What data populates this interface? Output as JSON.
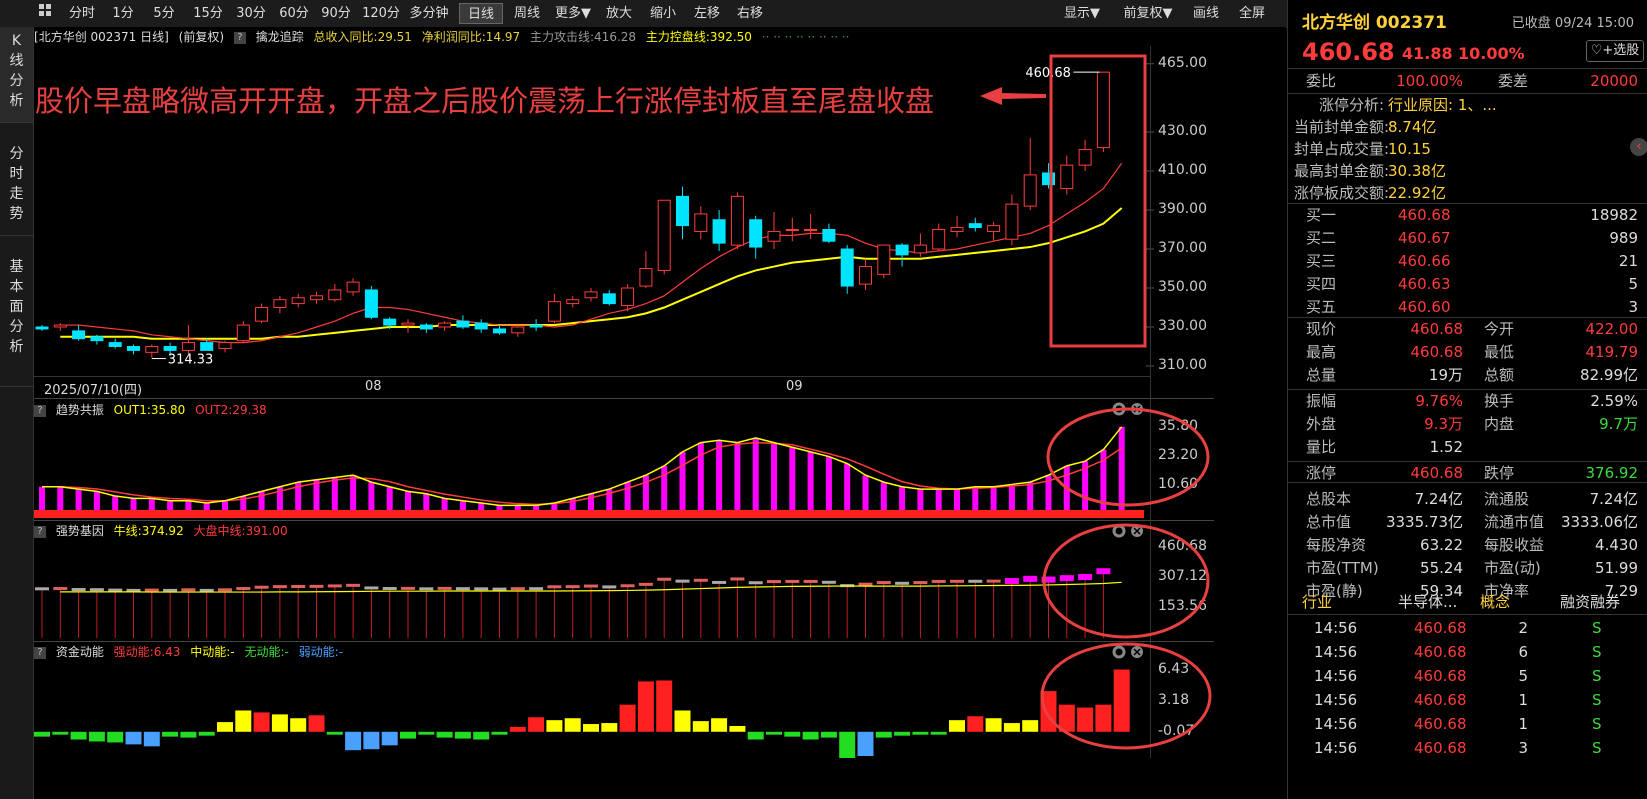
{
  "toolbar": {
    "items": [
      "分时",
      "1分",
      "5分",
      "15分",
      "30分",
      "60分",
      "90分",
      "120分",
      "多分钟",
      "日线",
      "周线",
      "更多▼",
      "放大",
      "缩小",
      "左移",
      "右移"
    ],
    "active": "日线",
    "right_items": [
      "显示▼",
      "前复权▼",
      "画线",
      "全屏"
    ]
  },
  "left_tabs": [
    {
      "label": "K线分析",
      "active": true
    },
    {
      "label": "分时走势",
      "active": false
    },
    {
      "label": "基本面分析",
      "active": false
    }
  ],
  "main_header": {
    "title": "北方华创 002371 日线",
    "adjust": "(前复权)",
    "indicator": "擒龙追踪",
    "revenue": "总收入同比:29.51",
    "profit": "净利润同比:14.97",
    "attack": "主力攻击线:416.28",
    "control": "主力控盘线:392.50",
    "dots": "·· ·· ·· ·· ·· ·· ·· ··"
  },
  "annotation": "股价早盘略微高开开盘，开盘之后股价震荡上行涨停封板直至尾盘收盘",
  "colors": {
    "up": "#ff3c3c",
    "down": "#00e5ff",
    "ma_fast": "#ff3c3c",
    "ma_slow": "#ffff00",
    "highlight": "#e84040",
    "magenta": "#ff00ff"
  },
  "chart_data": [
    {
      "type": "candlestick",
      "title": "北方华创 002371 日线",
      "ylim": [
        310,
        470
      ],
      "yticks": [
        "465.00",
        "430.00",
        "410.00",
        "390.00",
        "370.00",
        "350.00",
        "330.00",
        "310.00"
      ],
      "x_labels": [
        "2025/07/10(四)",
        "08",
        "09"
      ],
      "high_label": "460.68",
      "low_label": "314.33",
      "candles": [
        {
          "o": 330,
          "h": 331,
          "l": 328,
          "c": 329
        },
        {
          "o": 330,
          "h": 332,
          "l": 328,
          "c": 331
        },
        {
          "o": 328,
          "h": 331,
          "l": 323,
          "c": 324
        },
        {
          "o": 325,
          "h": 326,
          "l": 321,
          "c": 323
        },
        {
          "o": 322,
          "h": 324,
          "l": 319,
          "c": 320
        },
        {
          "o": 320,
          "h": 321,
          "l": 316,
          "c": 318
        },
        {
          "o": 317,
          "h": 321,
          "l": 314.33,
          "c": 320
        },
        {
          "o": 320,
          "h": 322,
          "l": 315,
          "c": 318
        },
        {
          "o": 318,
          "h": 331,
          "l": 316,
          "c": 322
        },
        {
          "o": 322,
          "h": 324,
          "l": 318,
          "c": 318
        },
        {
          "o": 319,
          "h": 323,
          "l": 317,
          "c": 322
        },
        {
          "o": 323,
          "h": 333,
          "l": 322,
          "c": 331
        },
        {
          "o": 333,
          "h": 342,
          "l": 332,
          "c": 340
        },
        {
          "o": 340,
          "h": 346,
          "l": 337,
          "c": 344
        },
        {
          "o": 342,
          "h": 347,
          "l": 340,
          "c": 345
        },
        {
          "o": 344,
          "h": 348,
          "l": 342,
          "c": 346
        },
        {
          "o": 344,
          "h": 352,
          "l": 343,
          "c": 349
        },
        {
          "o": 348,
          "h": 355,
          "l": 346,
          "c": 353
        },
        {
          "o": 349,
          "h": 351,
          "l": 334,
          "c": 335
        },
        {
          "o": 334,
          "h": 335,
          "l": 329,
          "c": 331
        },
        {
          "o": 331,
          "h": 334,
          "l": 327,
          "c": 332
        },
        {
          "o": 331,
          "h": 332,
          "l": 327,
          "c": 329
        },
        {
          "o": 330,
          "h": 333,
          "l": 328,
          "c": 332
        },
        {
          "o": 333,
          "h": 336,
          "l": 329,
          "c": 330
        },
        {
          "o": 332,
          "h": 334,
          "l": 327,
          "c": 329
        },
        {
          "o": 329,
          "h": 331,
          "l": 326,
          "c": 327
        },
        {
          "o": 327,
          "h": 331,
          "l": 325,
          "c": 330
        },
        {
          "o": 331,
          "h": 334,
          "l": 328,
          "c": 330
        },
        {
          "o": 333,
          "h": 347,
          "l": 332,
          "c": 343
        },
        {
          "o": 342,
          "h": 346,
          "l": 340,
          "c": 344
        },
        {
          "o": 345,
          "h": 350,
          "l": 343,
          "c": 348
        },
        {
          "o": 347,
          "h": 349,
          "l": 341,
          "c": 342
        },
        {
          "o": 341,
          "h": 352,
          "l": 338,
          "c": 350
        },
        {
          "o": 351,
          "h": 369,
          "l": 350,
          "c": 360
        },
        {
          "o": 359,
          "h": 395,
          "l": 357,
          "c": 395
        },
        {
          "o": 397,
          "h": 402,
          "l": 375,
          "c": 382
        },
        {
          "o": 379,
          "h": 392,
          "l": 375,
          "c": 388
        },
        {
          "o": 385,
          "h": 390,
          "l": 369,
          "c": 373
        },
        {
          "o": 372,
          "h": 399,
          "l": 370,
          "c": 397
        },
        {
          "o": 385,
          "h": 387,
          "l": 365,
          "c": 371
        },
        {
          "o": 374,
          "h": 389,
          "l": 370,
          "c": 379
        },
        {
          "o": 380,
          "h": 386,
          "l": 374,
          "c": 380
        },
        {
          "o": 380,
          "h": 388,
          "l": 375,
          "c": 380
        },
        {
          "o": 380,
          "h": 383,
          "l": 373,
          "c": 374
        },
        {
          "o": 370,
          "h": 372,
          "l": 347,
          "c": 351
        },
        {
          "o": 352,
          "h": 365,
          "l": 349,
          "c": 361
        },
        {
          "o": 357,
          "h": 372,
          "l": 355,
          "c": 372
        },
        {
          "o": 372,
          "h": 373,
          "l": 361,
          "c": 367
        },
        {
          "o": 368,
          "h": 378,
          "l": 366,
          "c": 372
        },
        {
          "o": 370,
          "h": 383,
          "l": 369,
          "c": 380
        },
        {
          "o": 379,
          "h": 387,
          "l": 376,
          "c": 381
        },
        {
          "o": 383,
          "h": 386,
          "l": 379,
          "c": 381
        },
        {
          "o": 379,
          "h": 384,
          "l": 374,
          "c": 382
        },
        {
          "o": 375,
          "h": 398,
          "l": 372,
          "c": 393
        },
        {
          "o": 392,
          "h": 427,
          "l": 390,
          "c": 408
        },
        {
          "o": 409,
          "h": 414,
          "l": 401,
          "c": 403
        },
        {
          "o": 401,
          "h": 418,
          "l": 398,
          "c": 413
        },
        {
          "o": 413,
          "h": 426,
          "l": 410,
          "c": 421
        },
        {
          "o": 422,
          "h": 460.68,
          "l": 419.79,
          "c": 460.68
        }
      ],
      "ma_fast": [
        331,
        331,
        330,
        329,
        328,
        326,
        325,
        324,
        323,
        322,
        322,
        323,
        325,
        327,
        330,
        333,
        337,
        340,
        340,
        339,
        337,
        335,
        333,
        332,
        331,
        331,
        331,
        330,
        331,
        334,
        337,
        339,
        342,
        346,
        353,
        360,
        366,
        371,
        375,
        377,
        377,
        378,
        378,
        377,
        373,
        370,
        369,
        368,
        369,
        370,
        372,
        374,
        376,
        378,
        382,
        388,
        394,
        401,
        414
      ],
      "ma_slow": [
        325,
        325,
        325,
        325,
        325,
        324,
        324,
        324,
        324,
        324,
        324,
        324,
        325,
        325,
        326,
        327,
        328,
        329,
        330,
        330,
        330,
        331,
        331,
        331,
        331,
        331,
        331,
        331,
        332,
        333,
        334,
        335,
        337,
        340,
        344,
        348,
        352,
        356,
        359,
        361,
        363,
        364,
        365,
        366,
        365,
        365,
        365,
        365,
        366,
        367,
        368,
        369,
        370,
        371,
        373,
        376,
        379,
        383,
        391
      ]
    },
    {
      "type": "bar",
      "title": "趋势共振",
      "legend": [
        "OUT1:35.80",
        "OUT2:29.38"
      ],
      "ylim": [
        0,
        37
      ],
      "yticks": [
        "35.80",
        "23.20",
        "10.60"
      ],
      "values": [
        10,
        10,
        9,
        8,
        6,
        5,
        5,
        4,
        4,
        3,
        4,
        6,
        8,
        10,
        12,
        13,
        14,
        15,
        12,
        10,
        8,
        7,
        5,
        4,
        3,
        2,
        2,
        2,
        3,
        5,
        7,
        9,
        12,
        15,
        19,
        25,
        29,
        30,
        29,
        31,
        29,
        27,
        25,
        23,
        20,
        15,
        12,
        10,
        9,
        9,
        9,
        10,
        10,
        11,
        12,
        15,
        19,
        21,
        26,
        35.8
      ]
    },
    {
      "type": "bar",
      "title": "强势基因",
      "legend": [
        "牛线:374.92",
        "大盘中线:391.00"
      ],
      "ylim": [
        0,
        470
      ],
      "yticks": [
        "460.68",
        "307.12",
        "153.56"
      ]
    },
    {
      "type": "bar",
      "title": "资金动能",
      "legend": [
        "强动能:6.43",
        "中动能:-",
        "无动能:-",
        "弱动能:-"
      ],
      "ylim": [
        -2.5,
        7
      ],
      "yticks": [
        "6.43",
        "3.18",
        "-0.07"
      ],
      "values": [
        -0.5,
        -0.3,
        -0.8,
        -1.0,
        -1.1,
        -1.3,
        -1.5,
        -0.5,
        -0.6,
        -0.4,
        1.0,
        2.2,
        2.0,
        1.8,
        1.4,
        1.7,
        -0.3,
        -1.9,
        -1.8,
        -1.4,
        -0.7,
        -0.3,
        -0.6,
        -0.7,
        -0.8,
        -0.3,
        0.5,
        1.5,
        1.2,
        1.4,
        0.8,
        0.9,
        2.8,
        5.2,
        5.3,
        2.2,
        1.1,
        1.4,
        0.6,
        -0.8,
        -0.3,
        -0.5,
        -0.8,
        -0.6,
        -3.2,
        -2.5,
        -0.6,
        -0.4,
        -0.3,
        -0.3,
        1.2,
        1.6,
        1.4,
        0.9,
        1.2,
        4.2,
        2.8,
        2.5,
        2.8,
        6.43
      ]
    }
  ],
  "panel_values": {
    "strong_gene_max": "460.68"
  },
  "quote": {
    "name": "北方华创 002371",
    "status": "已收盘 09/24 15:00",
    "price": "460.68",
    "change": "41.88",
    "pct": "10.00%",
    "fav": "+选股",
    "weibi_label": "委比",
    "weibi": "100.00%",
    "weicha_label": "委差",
    "weicha": "20000",
    "limit_info": [
      {
        "label": "涨停分析:",
        "value": "行业原因: 1、..."
      },
      {
        "label": "当前封单金额:",
        "value": "8.74亿"
      },
      {
        "label": "封单占成交量:",
        "value": "10.15"
      },
      {
        "label": "最高封单金额:",
        "value": "30.38亿"
      },
      {
        "label": "涨停板成交额:",
        "value": "22.92亿"
      }
    ],
    "bids": [
      {
        "label": "买一",
        "price": "460.68",
        "vol": "18982"
      },
      {
        "label": "买二",
        "price": "460.67",
        "vol": "989"
      },
      {
        "label": "买三",
        "price": "460.66",
        "vol": "21"
      },
      {
        "label": "买四",
        "price": "460.63",
        "vol": "5"
      },
      {
        "label": "买五",
        "price": "460.60",
        "vol": "3"
      }
    ],
    "stats": [
      {
        "l1": "现价",
        "v1": "460.68",
        "c1": "up",
        "l2": "今开",
        "v2": "422.00",
        "c2": "up"
      },
      {
        "l1": "最高",
        "v1": "460.68",
        "c1": "up",
        "l2": "最低",
        "v2": "419.79",
        "c2": "up"
      },
      {
        "l1": "总量",
        "v1": "19万",
        "c1": "w",
        "l2": "总额",
        "v2": "82.99亿",
        "c2": "w"
      },
      {
        "l1": "振幅",
        "v1": "9.76%",
        "c1": "up",
        "l2": "换手",
        "v2": "2.59%",
        "c2": "w"
      },
      {
        "l1": "外盘",
        "v1": "9.3万",
        "c1": "up",
        "l2": "内盘",
        "v2": "9.7万",
        "c2": "dn"
      },
      {
        "l1": "量比",
        "v1": "1.52",
        "c1": "w",
        "l2": "",
        "v2": "",
        "c2": "w"
      },
      {
        "l1": "涨停",
        "v1": "460.68",
        "c1": "up",
        "l2": "跌停",
        "v2": "376.92",
        "c2": "dn"
      },
      {
        "l1": "总股本",
        "v1": "7.24亿",
        "c1": "w",
        "l2": "流通股",
        "v2": "7.24亿",
        "c2": "w"
      },
      {
        "l1": "总市值",
        "v1": "3335.73亿",
        "c1": "w",
        "l2": "流通市值",
        "v2": "3333.06亿",
        "c2": "w"
      },
      {
        "l1": "每股净资",
        "v1": "63.22",
        "c1": "w",
        "l2": "每股收益",
        "v2": "4.430",
        "c2": "w"
      },
      {
        "l1": "市盈(TTM)",
        "v1": "55.24",
        "c1": "w",
        "l2": "市盈(动)",
        "v2": "51.99",
        "c2": "w"
      },
      {
        "l1": "市盈(静)",
        "v1": "59.34",
        "c1": "w",
        "l2": "市净率",
        "v2": "7.29",
        "c2": "w"
      }
    ],
    "tabs": [
      "行业",
      "半导体...",
      "概念",
      "融资融券"
    ],
    "ticks": [
      {
        "time": "14:56",
        "price": "460.68",
        "vol": "2",
        "flag": "S"
      },
      {
        "time": "14:56",
        "price": "460.68",
        "vol": "6",
        "flag": "S"
      },
      {
        "time": "14:56",
        "price": "460.68",
        "vol": "5",
        "flag": "S"
      },
      {
        "time": "14:56",
        "price": "460.68",
        "vol": "1",
        "flag": "S"
      },
      {
        "time": "14:56",
        "price": "460.68",
        "vol": "1",
        "flag": "S"
      },
      {
        "time": "14:56",
        "price": "460.68",
        "vol": "3",
        "flag": "S"
      }
    ]
  }
}
